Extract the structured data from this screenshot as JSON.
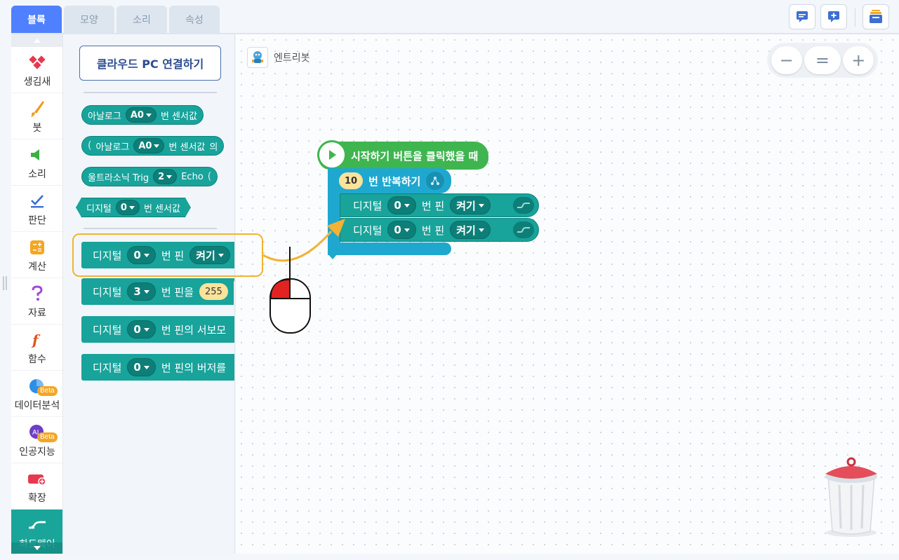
{
  "tabs": [
    {
      "label": "블록",
      "active": true
    },
    {
      "label": "모양",
      "active": false
    },
    {
      "label": "소리",
      "active": false
    },
    {
      "label": "속성",
      "active": false
    }
  ],
  "categories": [
    {
      "label": "생김새",
      "icon": "looks-icon",
      "color": "#e8384f"
    },
    {
      "label": "붓",
      "icon": "brush-icon",
      "color": "#f39a1e"
    },
    {
      "label": "소리",
      "icon": "speaker-icon",
      "color": "#3cb043"
    },
    {
      "label": "판단",
      "icon": "check-icon",
      "color": "#3a6fd8"
    },
    {
      "label": "계산",
      "icon": "calculator-icon",
      "color": "#f4a623"
    },
    {
      "label": "자료",
      "icon": "question-icon",
      "color": "#a24bd6"
    },
    {
      "label": "함수",
      "icon": "function-icon",
      "color": "#e0541b"
    },
    {
      "label": "데이터분석",
      "icon": "pie-chart-icon",
      "badge": "Beta",
      "color": "#2e8ee6"
    },
    {
      "label": "인공지능",
      "icon": "ai-icon",
      "badge": "Beta",
      "color": "#6f3dc7"
    },
    {
      "label": "확장",
      "icon": "extension-icon",
      "color": "#e8384f"
    },
    {
      "label": "하드웨어",
      "icon": "hardware-icon",
      "active": true,
      "color": "#ffffff"
    }
  ],
  "palette": {
    "cloud_button": "클라우드 PC 연결하기",
    "reporters": [
      {
        "prefix": "아날로그",
        "dropdown": "A0",
        "suffix": "번 센서값"
      },
      {
        "prefix": "아날로그",
        "dropdown": "A0",
        "suffix": "번 센서값",
        "tail": "의"
      },
      {
        "prefix": "울트라소닉 Trig",
        "dropdown": "2",
        "suffix": "Echo"
      },
      {
        "prefix": "디지털",
        "dropdown": "0",
        "suffix": "번 센서값"
      }
    ],
    "commands": [
      {
        "prefix": "디지털",
        "dropdown": "0",
        "middle": "번 핀",
        "value": "켜기"
      },
      {
        "prefix": "디지털",
        "dropdown": "3",
        "middle": "번 핀을",
        "value": "255"
      },
      {
        "prefix": "디지털",
        "dropdown": "0",
        "middle": "번 핀의 서보모"
      },
      {
        "prefix": "디지털",
        "dropdown": "0",
        "middle": "번 핀의 버저를"
      }
    ]
  },
  "workspace": {
    "object_name": "엔트리봇",
    "zoom": {
      "out": "−",
      "reset": "=",
      "in": "+"
    },
    "script": {
      "hat": "시작하기 버튼을 클릭했을 때",
      "loop": {
        "count": "10",
        "label": "번 반복하기"
      },
      "commands": [
        {
          "prefix": "디지털",
          "dropdown": "0",
          "middle": "번 핀",
          "value": "켜기"
        },
        {
          "prefix": "디지털",
          "dropdown": "0",
          "middle": "번 핀",
          "value": "켜기"
        }
      ]
    }
  },
  "colors": {
    "accent": "#4f80ff",
    "hardware_block": "#18a39b",
    "start_block": "#3fb550",
    "loop_block": "#1fa8cf",
    "highlight": "#f3b233"
  }
}
